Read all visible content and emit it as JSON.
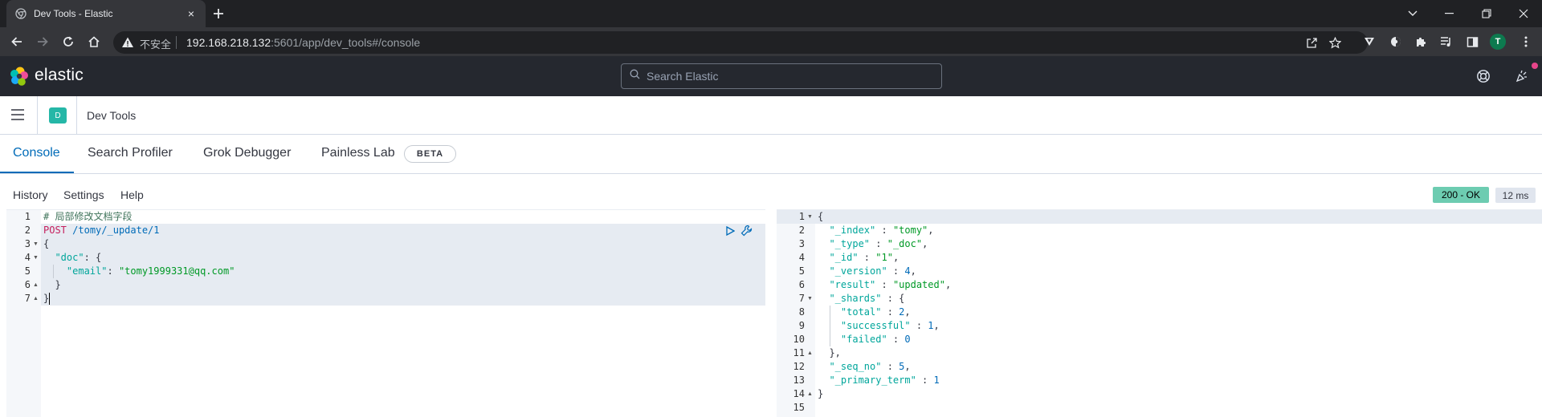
{
  "browser": {
    "tab_title": "Dev Tools - Elastic",
    "close_glyph": "×",
    "insecure_label": "不安全",
    "url_host": "192.168.218.132",
    "url_rest": ":5601/app/dev_tools#/console",
    "profile_initial": "T"
  },
  "kibana": {
    "brand": "elastic",
    "search_placeholder": "Search Elastic",
    "space_initial": "D",
    "breadcrumb": "Dev Tools"
  },
  "tabs": [
    {
      "label": "Console"
    },
    {
      "label": "Search Profiler"
    },
    {
      "label": "Grok Debugger"
    },
    {
      "label": "Painless Lab"
    }
  ],
  "beta_label": "BETA",
  "console_menu": [
    "History",
    "Settings",
    "Help"
  ],
  "status": {
    "code": "200 - OK",
    "time": "12 ms"
  },
  "colors": {
    "accent": "#006bb8",
    "status_ok": "#6dccb1",
    "header": "#25282f",
    "space": "#25b7a7"
  },
  "request": {
    "line_numbers": [
      "1",
      "2",
      "3",
      "4",
      "5",
      "6",
      "7"
    ],
    "lines": [
      "# 局部修改文档字段",
      "POST",
      "/tomy/_update/1",
      "{",
      "\"doc\"",
      "\"email\"",
      "\"tomy1999331@qq.com\"",
      "}",
      "}"
    ]
  },
  "response": {
    "line_numbers": [
      "1",
      "2",
      "3",
      "4",
      "5",
      "6",
      "7",
      "8",
      "9",
      "10",
      "11",
      "12",
      "13",
      "14",
      "15"
    ],
    "keys": [
      "\"_index\"",
      "\"_type\"",
      "\"_id\"",
      "\"_version\"",
      "\"result\"",
      "\"_shards\"",
      "\"total\"",
      "\"successful\"",
      "\"failed\"",
      "\"_seq_no\"",
      "\"_primary_term\""
    ],
    "values": [
      "\"tomy\"",
      "\"_doc\"",
      "\"1\"",
      "4",
      "\"updated\"",
      "2",
      "1",
      "0",
      "5",
      "1"
    ]
  },
  "icons": [
    "chrome-favicon",
    "new-tab-icon",
    "back-icon",
    "forward-icon",
    "reload-icon",
    "home-icon",
    "warning-icon",
    "share-icon",
    "star-icon",
    "extension-icon",
    "puzzle-icon",
    "media-icon",
    "sidepanel-icon",
    "menu-icon",
    "search-icon",
    "help-icon",
    "news-icon",
    "hamburger-icon",
    "play-icon",
    "wrench-icon"
  ]
}
